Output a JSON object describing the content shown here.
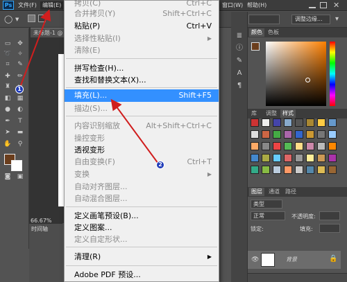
{
  "app": {
    "logo": "Ps"
  },
  "menubar": {
    "file": "文件(F)",
    "edit": "编辑(E)",
    "window": "窗口(W)",
    "help": "帮助(H)"
  },
  "options": {
    "workspace": "调整边缘..."
  },
  "document": {
    "tab": "未标题-1 @",
    "zoom": "66.67%"
  },
  "timeline": {
    "tab": "时间轴"
  },
  "color_panel": {
    "tab_color": "颜色",
    "tab_swatches": "色板"
  },
  "styles_panel": {
    "tab_library": "库",
    "tab_adjust": "调整",
    "tab_styles": "样式"
  },
  "layers_panel": {
    "tab_layers": "图层",
    "tab_channels": "通道",
    "tab_paths": "路径",
    "kind_filter": "类型",
    "blend_mode": "正常",
    "opacity_label": "不透明度:",
    "lock_label": "锁定:",
    "fill_label": "填充:",
    "layer_name": "背景"
  },
  "edit_menu": {
    "items": [
      {
        "label": "拷贝(C)",
        "shortcut": "Ctrl+C",
        "disabled": true
      },
      {
        "label": "合并拷贝(Y)",
        "shortcut": "Shift+Ctrl+C",
        "disabled": true
      },
      {
        "label": "粘贴(P)",
        "shortcut": "Ctrl+V",
        "disabled": false
      },
      {
        "label": "选择性粘贴(I)",
        "submenu": true,
        "disabled": true
      },
      {
        "label": "清除(E)",
        "disabled": true
      },
      {
        "label": "拼写检查(H)...",
        "disabled": false
      },
      {
        "label": "查找和替换文本(X)...",
        "disabled": false
      },
      {
        "label": "填充(L)...",
        "shortcut": "Shift+F5",
        "highlighted": true
      },
      {
        "label": "描边(S)...",
        "disabled": true
      },
      {
        "label": "内容识别缩放",
        "shortcut": "Alt+Shift+Ctrl+C",
        "disabled": true
      },
      {
        "label": "操控变形",
        "disabled": true
      },
      {
        "label": "透视变形",
        "disabled": false
      },
      {
        "label": "自由变换(F)",
        "shortcut": "Ctrl+T",
        "disabled": true
      },
      {
        "label": "变换",
        "submenu": true,
        "disabled": true
      },
      {
        "label": "自动对齐图层...",
        "disabled": true
      },
      {
        "label": "自动混合图层...",
        "disabled": true
      },
      {
        "label": "定义画笔预设(B)...",
        "disabled": false
      },
      {
        "label": "定义图案...",
        "disabled": false
      },
      {
        "label": "定义自定形状...",
        "disabled": true
      },
      {
        "label": "清理(R)",
        "submenu": true,
        "disabled": false
      },
      {
        "label": "Adobe PDF 预设...",
        "disabled": false
      }
    ]
  },
  "annotations": {
    "step1": "1",
    "step2": "2"
  },
  "colors": {
    "highlight": "#3390ff",
    "arrow": "#d01e1e",
    "foreground": "#6a3d1c",
    "badge": "#1e3ab8"
  }
}
